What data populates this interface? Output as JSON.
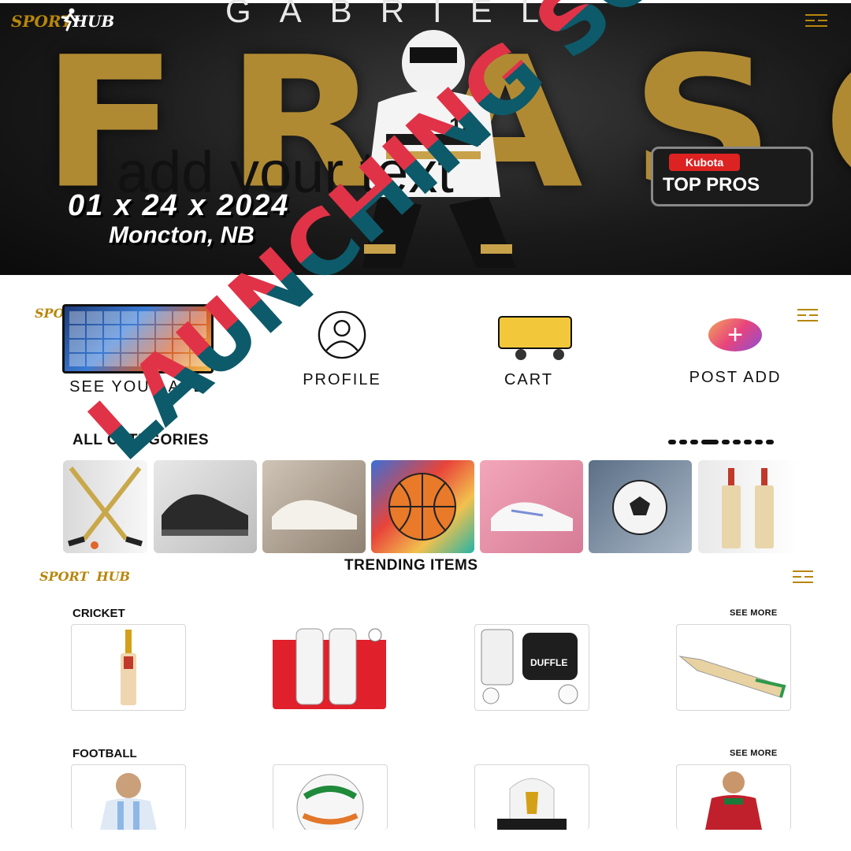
{
  "brand": {
    "part1": "SPORT",
    "part2": "HUB"
  },
  "hero": {
    "small_title": "GABRIEL",
    "big_title": "FRASCA",
    "overlay_text": "add your text",
    "date": "01 x 24 x 2024",
    "location": "Moncton, NB",
    "badge_top": "Kubota",
    "badge_main": "TOP PROS"
  },
  "nav": {
    "items": [
      {
        "label": "SEE YOUR ADD",
        "icon": "tv-remote-icon"
      },
      {
        "label": "PROFILE",
        "icon": "user-icon"
      },
      {
        "label": "CART",
        "icon": "cart-icon"
      },
      {
        "label": "POST ADD",
        "icon": "plus-icon"
      }
    ]
  },
  "categories": {
    "title": "ALL CATEGORIES",
    "page_count": 9,
    "active_page": 3,
    "tiles": [
      "hockey sticks",
      "sneakers",
      "white shoes",
      "basketball",
      "running shoes",
      "football",
      "cricket bats"
    ]
  },
  "trending": {
    "title": "TRENDING ITEMS",
    "sections": [
      {
        "label": "CRICKET",
        "see_more": "SEE MORE",
        "items": [
          "cricket bat",
          "batting pads",
          "duffle kit",
          "cricket bat"
        ]
      },
      {
        "label": "FOOTBALL",
        "see_more": "SEE MORE",
        "items": [
          "player jersey",
          "football",
          "world cup trophy",
          "player jersey"
        ]
      }
    ]
  },
  "watermark": {
    "text": "LAUNCHING SOON"
  },
  "colors": {
    "gold": "#b08a33",
    "launch_red": "#e03347",
    "launch_teal": "#0d5a6a",
    "menu_gold": "#b8860b"
  }
}
